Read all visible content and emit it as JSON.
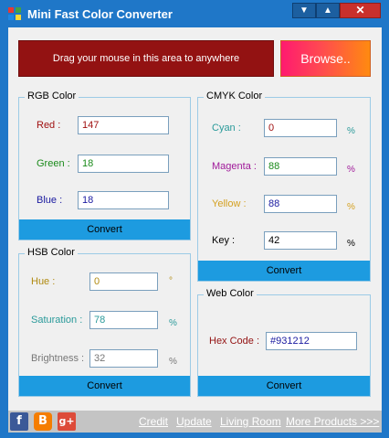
{
  "window": {
    "title": "Mini Fast Color Converter",
    "minimize_glyph": "▼",
    "maximize_glyph": "▲",
    "close_glyph": "✕"
  },
  "drag_area": {
    "label": "Drag your mouse in this area to anywhere"
  },
  "browse": {
    "label": "Browse.."
  },
  "rgb": {
    "title": "RGB Color",
    "red_label": "Red :",
    "red_value": "147",
    "green_label": "Green :",
    "green_value": "18",
    "blue_label": "Blue :",
    "blue_value": "18",
    "convert": "Convert"
  },
  "cmyk": {
    "title": "CMYK Color",
    "cyan_label": "Cyan :",
    "cyan_value": "0",
    "magenta_label": "Magenta :",
    "magenta_value": "88",
    "yellow_label": "Yellow :",
    "yellow_value": "88",
    "key_label": "Key :",
    "key_value": "42",
    "unit": "%",
    "convert": "Convert"
  },
  "hsb": {
    "title": "HSB Color",
    "hue_label": "Hue :",
    "hue_value": "0",
    "hue_unit": "°",
    "saturation_label": "Saturation :",
    "saturation_value": "78",
    "brightness_label": "Brightness :",
    "brightness_value": "32",
    "unit": "%",
    "convert": "Convert"
  },
  "web": {
    "title": "Web Color",
    "hex_label": "Hex Code :",
    "hex_value": "#931212",
    "convert": "Convert"
  },
  "footer": {
    "facebook_glyph": "f",
    "blogger_glyph": "B",
    "gplus_glyph": "g+",
    "links": [
      "Credit",
      "Update",
      "Living Room",
      "More Products >>>"
    ]
  },
  "colors": {
    "title_bar": "#1f77c8",
    "drag_area": "#931212",
    "convert_button": "#1d9be0",
    "red": "#a01010",
    "green": "#1a8a1a",
    "blue": "#1a1aa0",
    "cyan": "#2a9a9a",
    "magenta": "#a01a9a",
    "yellow": "#d4a020",
    "key": "#000000"
  }
}
